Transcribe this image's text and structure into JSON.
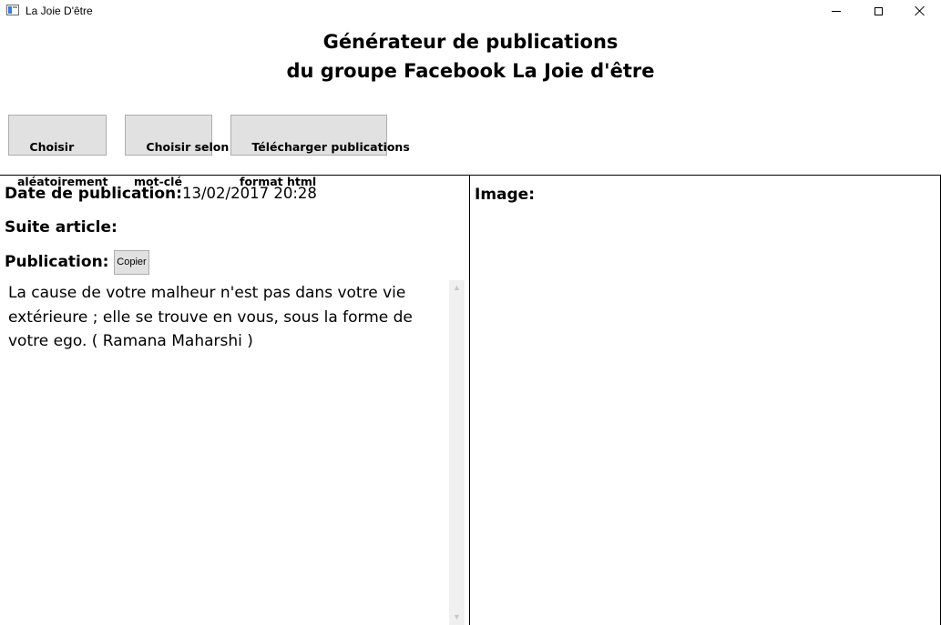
{
  "window": {
    "title": "La Joie D'être",
    "minimize_glyph": "—",
    "maximize_glyph": "☐",
    "close_glyph": "✕"
  },
  "header": {
    "line1": "Générateur de publications",
    "line2": "du groupe Facebook La Joie d'être"
  },
  "toolbar": {
    "random": {
      "line1": "Choisir",
      "line2": "aléatoirement"
    },
    "keyword": {
      "line1": "Choisir selon",
      "line2": "mot-clé"
    },
    "download": {
      "line1": "Télécharger publications",
      "line2": "format html"
    }
  },
  "left_panel": {
    "date_label": "Date de publication:",
    "date_value": "13/02/2017 20:28",
    "suite_label": "Suite article:",
    "publication_label": "Publication:",
    "copy_button": "Copier",
    "publication_text": "La cause de votre malheur n'est pas dans votre vie extérieure ; elle se trouve en vous, sous la forme de votre ego. ( Ramana Maharshi )"
  },
  "right_panel": {
    "image_label": "Image:"
  },
  "icons": {
    "app": "app-window-icon",
    "scroll_up": "chevron-up-icon",
    "scroll_down": "chevron-down-icon"
  }
}
